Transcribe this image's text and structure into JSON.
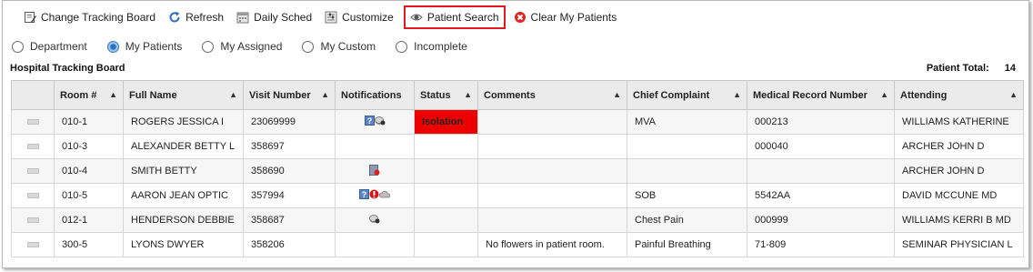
{
  "toolbar": {
    "items": [
      {
        "label": "Change Tracking Board",
        "icon": "edit-board-icon"
      },
      {
        "label": "Refresh",
        "icon": "refresh-icon"
      },
      {
        "label": "Daily Sched",
        "icon": "schedule-icon"
      },
      {
        "label": "Customize",
        "icon": "customize-icon"
      },
      {
        "label": "Patient Search",
        "icon": "eye-search-icon",
        "highlighted": true
      },
      {
        "label": "Clear My Patients",
        "icon": "clear-x-icon"
      }
    ]
  },
  "filters": {
    "options": [
      "Department",
      "My Patients",
      "My Assigned",
      "My Custom",
      "Incomplete"
    ],
    "selected": "My Patients"
  },
  "board": {
    "title": "Hospital Tracking Board",
    "total_label": "Patient Total:",
    "total_value": "14"
  },
  "table": {
    "headers": [
      "Room #",
      "Full Name",
      "Visit Number",
      "Notifications",
      "Status",
      "Comments",
      "Chief Complaint",
      "Medical Record Number",
      "Attending"
    ],
    "rows": [
      {
        "room": "010-1",
        "name": "ROGERS JESSICA I",
        "visit": "23069999",
        "notifications": [
          "info-icon",
          "pill-icon"
        ],
        "status": "Isolation",
        "comments": "",
        "complaint": "MVA",
        "mrn": "000213",
        "attending": "WILLIAMS KATHERINE"
      },
      {
        "room": "010-3",
        "name": "ALEXANDER BETTY L",
        "visit": "358697",
        "notifications": [],
        "status": "",
        "comments": "",
        "complaint": "",
        "mrn": "000040",
        "attending": "ARCHER JOHN D"
      },
      {
        "room": "010-4",
        "name": "SMITH BETTY",
        "visit": "358690",
        "notifications": [
          "alert-doc-icon"
        ],
        "status": "",
        "comments": "",
        "complaint": "",
        "mrn": "",
        "attending": "ARCHER JOHN D"
      },
      {
        "room": "010-5",
        "name": "AARON JEAN OPTIC",
        "visit": "357994",
        "notifications": [
          "info-icon",
          "allergy-icon",
          "cloud-icon"
        ],
        "status": "",
        "comments": "",
        "complaint": "SOB",
        "mrn": "5542AA",
        "attending": "DAVID MCCUNE MD"
      },
      {
        "room": "012-1",
        "name": "HENDERSON DEBBIE",
        "visit": "358687",
        "notifications": [
          "pill-icon"
        ],
        "status": "",
        "comments": "",
        "complaint": "Chest Pain",
        "mrn": "000999",
        "attending": "WILLIAMS KERRI B MD"
      },
      {
        "room": "300-5",
        "name": "LYONS DWYER",
        "visit": "358206",
        "notifications": [],
        "status": "",
        "comments": "No flowers in patient room.",
        "complaint": "Painful Breathing",
        "mrn": "71-809",
        "attending": "SEMINAR PHYSICIAN L"
      }
    ]
  }
}
